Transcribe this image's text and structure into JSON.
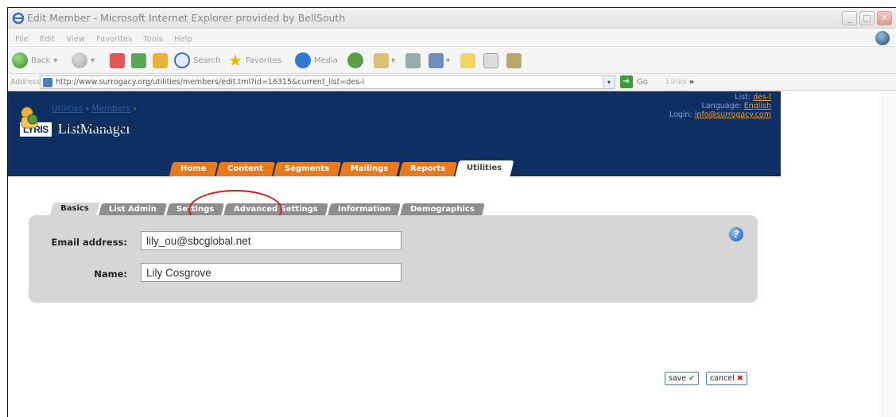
{
  "window": {
    "title": "Edit Member - Microsoft Internet Explorer provided by BellSouth"
  },
  "menu": [
    "File",
    "Edit",
    "View",
    "Favorites",
    "Tools",
    "Help"
  ],
  "toolbar": {
    "back": "Back",
    "search": "Search",
    "favorites": "Favorites",
    "media": "Media"
  },
  "address": {
    "label": "Address",
    "url": "http://www.surrogacy.org/utilities/members/edit.tml?id=16315&current_list=des-l",
    "go": "Go",
    "links": "Links"
  },
  "header": {
    "logo_box": "LYRIS",
    "app_name": "ListManager",
    "list_label": "List:",
    "list_value": "des-l",
    "language_label": "Language:",
    "language_value": "English",
    "login_label": "Login:",
    "login_value": "info@surrogacy.com"
  },
  "nav_tabs": [
    {
      "label": "Home"
    },
    {
      "label": "Content"
    },
    {
      "label": "Segments"
    },
    {
      "label": "Mailings"
    },
    {
      "label": "Reports"
    },
    {
      "label": "Utilities",
      "active": true
    }
  ],
  "breadcrumb": {
    "item1": "Utilities",
    "item2": "Members",
    "sep": "›"
  },
  "page_title": "Edit Member",
  "sub_tabs": [
    {
      "label": "Basics",
      "active": true
    },
    {
      "label": "List Admin"
    },
    {
      "label": "Settings"
    },
    {
      "label": "Advanced Settings"
    },
    {
      "label": "Information"
    },
    {
      "label": "Demographics"
    }
  ],
  "form": {
    "email_label": "Email address:",
    "email_value": "lily_ou@sbcglobal.net",
    "name_label": "Name:",
    "name_value": "Lily Cosgrove"
  },
  "actions": {
    "save": "save",
    "cancel": "cancel"
  },
  "colors": {
    "header_bg": "#0d2f64",
    "nav_tab": "#e87a1e",
    "sub_tab": "#8e8e8e",
    "panel": "#d6d6d6",
    "highlight_ring": "#d81b1b"
  }
}
